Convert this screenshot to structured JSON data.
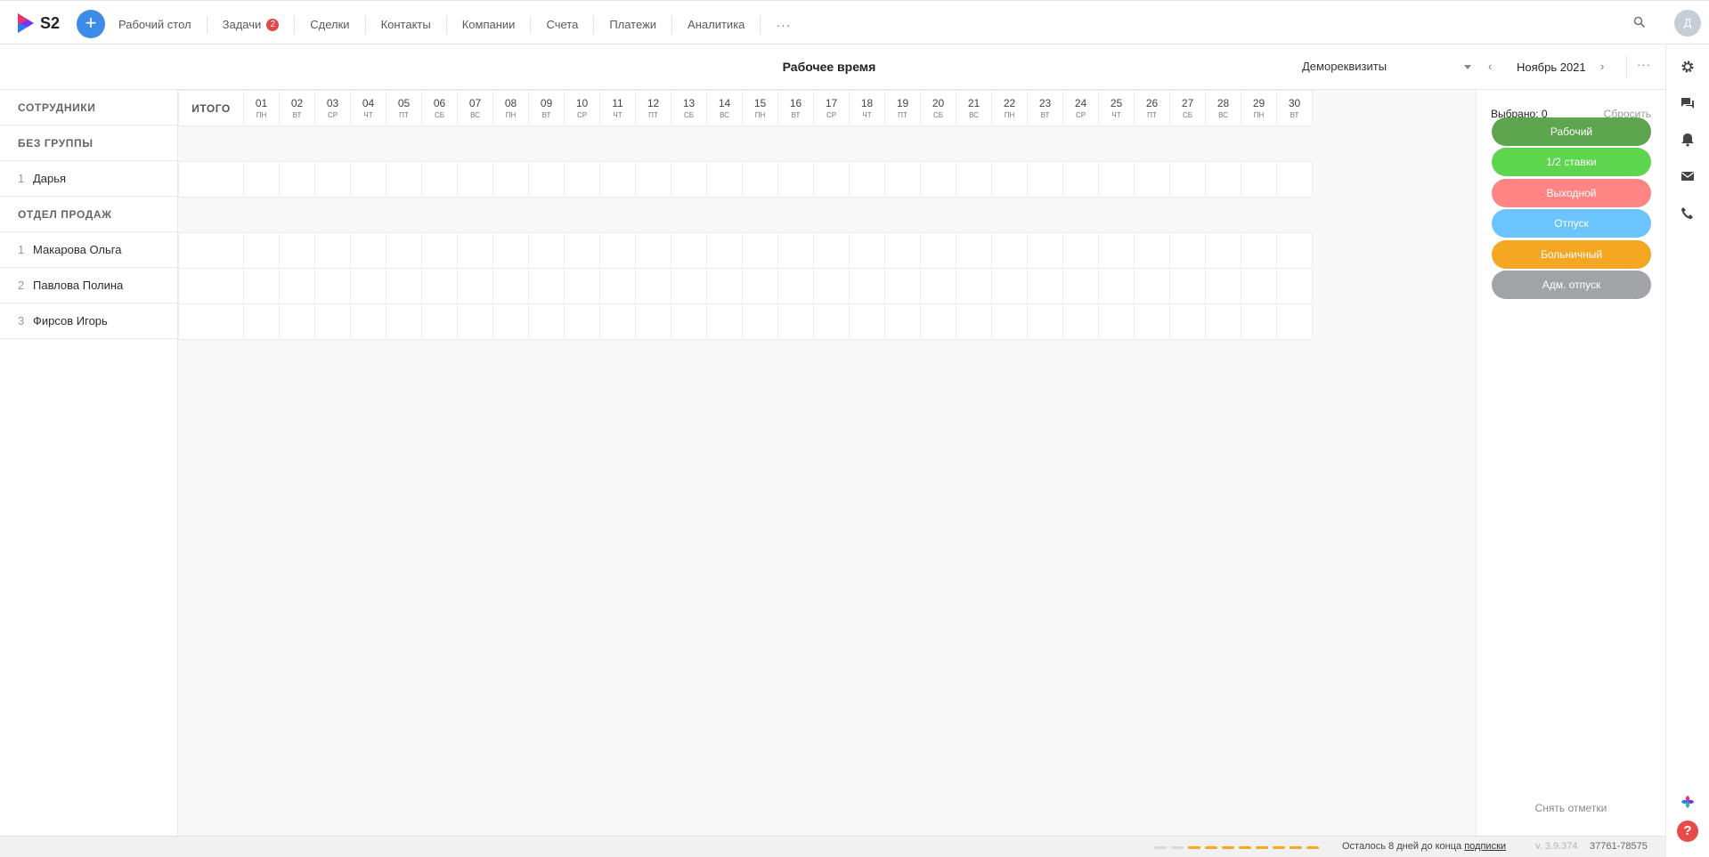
{
  "app": {
    "logo_text": "S2",
    "add_label": "+",
    "avatar_letter": "Д"
  },
  "nav": [
    {
      "label": "Рабочий стол"
    },
    {
      "label": "Задачи",
      "badge": "2"
    },
    {
      "label": "Сделки"
    },
    {
      "label": "Контакты"
    },
    {
      "label": "Компании"
    },
    {
      "label": "Счета"
    },
    {
      "label": "Платежи"
    },
    {
      "label": "Аналитика"
    }
  ],
  "nav_more": "···",
  "header": {
    "title": "Рабочее время",
    "requisites": "Демореквизиты",
    "month": "Ноябрь 2021",
    "prev": "‹",
    "next": "›",
    "more": "···"
  },
  "employees_header": "СОТРУДНИКИ",
  "total_header": "ИТОГО",
  "days": [
    {
      "n": "01",
      "w": "пн"
    },
    {
      "n": "02",
      "w": "вт"
    },
    {
      "n": "03",
      "w": "ср"
    },
    {
      "n": "04",
      "w": "чт"
    },
    {
      "n": "05",
      "w": "пт"
    },
    {
      "n": "06",
      "w": "сб"
    },
    {
      "n": "07",
      "w": "вс"
    },
    {
      "n": "08",
      "w": "пн"
    },
    {
      "n": "09",
      "w": "вт"
    },
    {
      "n": "10",
      "w": "ср"
    },
    {
      "n": "11",
      "w": "чт"
    },
    {
      "n": "12",
      "w": "пт"
    },
    {
      "n": "13",
      "w": "сб"
    },
    {
      "n": "14",
      "w": "вс"
    },
    {
      "n": "15",
      "w": "пн"
    },
    {
      "n": "16",
      "w": "вт"
    },
    {
      "n": "17",
      "w": "ср"
    },
    {
      "n": "18",
      "w": "чт"
    },
    {
      "n": "19",
      "w": "пт"
    },
    {
      "n": "20",
      "w": "сб"
    },
    {
      "n": "21",
      "w": "вс"
    },
    {
      "n": "22",
      "w": "пн"
    },
    {
      "n": "23",
      "w": "вт"
    },
    {
      "n": "24",
      "w": "ср"
    },
    {
      "n": "25",
      "w": "чт"
    },
    {
      "n": "26",
      "w": "пт"
    },
    {
      "n": "27",
      "w": "сб"
    },
    {
      "n": "28",
      "w": "вс"
    },
    {
      "n": "29",
      "w": "пн"
    },
    {
      "n": "30",
      "w": "вт"
    }
  ],
  "groups": [
    {
      "name": "БЕЗ ГРУППЫ",
      "employees": [
        {
          "num": "1",
          "name": "Дарья"
        }
      ]
    },
    {
      "name": "ОТДЕЛ ПРОДАЖ",
      "employees": [
        {
          "num": "1",
          "name": "Макарова Ольга"
        },
        {
          "num": "2",
          "name": "Павлова Полина"
        },
        {
          "num": "3",
          "name": "Фирсов Игорь"
        }
      ]
    }
  ],
  "panel": {
    "selected": "Выбрано: 0",
    "reset": "Сбросить",
    "statuses": [
      {
        "label": "Рабочий",
        "color": "#5ea54f"
      },
      {
        "label": "1/2 ставки",
        "color": "#5ed54f"
      },
      {
        "label": "Выходной",
        "color": "#ff8585"
      },
      {
        "label": "Отпуск",
        "color": "#6cc4ff"
      },
      {
        "label": "Больничный",
        "color": "#f5a623"
      },
      {
        "label": "Адм. отпуск",
        "color": "#a1a3a6"
      }
    ],
    "clear": "Снять отметки"
  },
  "footer": {
    "progress_total": 10,
    "progress_used": 2,
    "text": "Осталось 8 дней до конца ",
    "link": "подписки",
    "version": "v. 3.9.374",
    "build": "37761-78575"
  },
  "colors": {
    "accent": "#3d8de8",
    "badge": "#e34848",
    "progress_active": "#f5a623",
    "progress_inactive": "#d9d9d9",
    "help": "#e84a4a"
  },
  "right_icons": [
    "gear-icon",
    "chat-icon",
    "bell-icon",
    "mail-icon",
    "phone-icon",
    "widget-icon",
    "help-icon"
  ]
}
